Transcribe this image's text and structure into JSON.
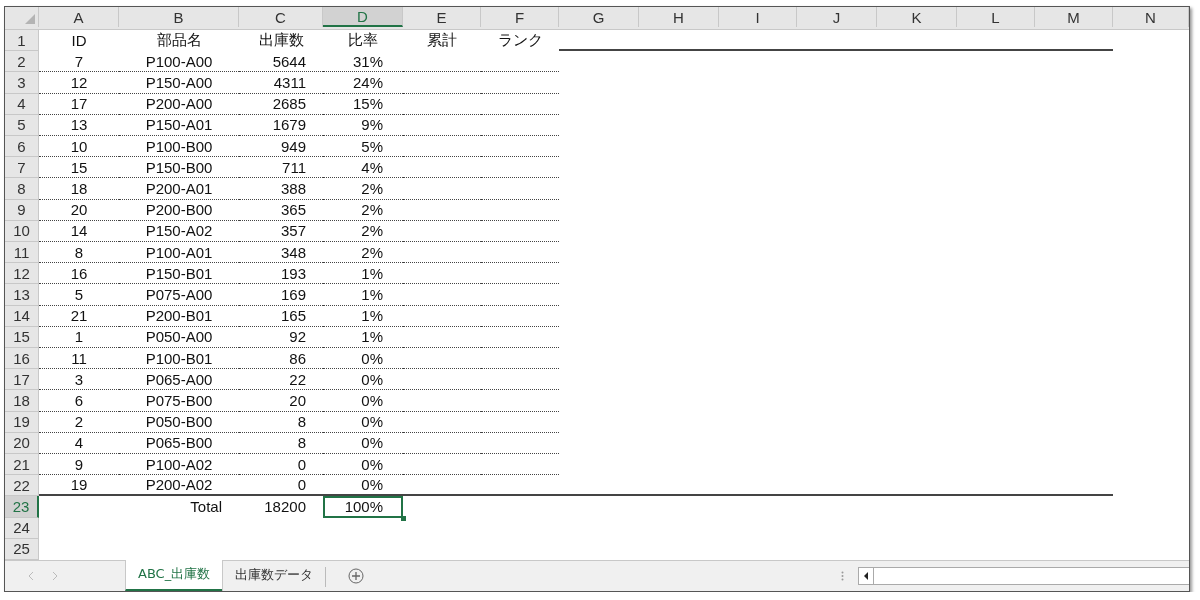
{
  "columns": [
    {
      "label": "A",
      "selected": false
    },
    {
      "label": "B",
      "selected": false
    },
    {
      "label": "C",
      "selected": false
    },
    {
      "label": "D",
      "selected": true
    },
    {
      "label": "E",
      "selected": false
    },
    {
      "label": "F",
      "selected": false
    },
    {
      "label": "G",
      "selected": false
    },
    {
      "label": "H",
      "selected": false
    },
    {
      "label": "I",
      "selected": false
    },
    {
      "label": "J",
      "selected": false
    },
    {
      "label": "K",
      "selected": false
    },
    {
      "label": "L",
      "selected": false
    },
    {
      "label": "M",
      "selected": false
    },
    {
      "label": "N",
      "selected": false
    }
  ],
  "header_row": {
    "number": "1",
    "selected": false,
    "cells": [
      "ID",
      "部品名",
      "出庫数",
      "比率",
      "累計",
      "ランク"
    ]
  },
  "rows": [
    {
      "number": "2",
      "selected": false,
      "id": "7",
      "part": "P100-A00",
      "qty": "5644",
      "ratio": "31%"
    },
    {
      "number": "3",
      "selected": false,
      "id": "12",
      "part": "P150-A00",
      "qty": "4311",
      "ratio": "24%"
    },
    {
      "number": "4",
      "selected": false,
      "id": "17",
      "part": "P200-A00",
      "qty": "2685",
      "ratio": "15%"
    },
    {
      "number": "5",
      "selected": false,
      "id": "13",
      "part": "P150-A01",
      "qty": "1679",
      "ratio": "9%"
    },
    {
      "number": "6",
      "selected": false,
      "id": "10",
      "part": "P100-B00",
      "qty": "949",
      "ratio": "5%"
    },
    {
      "number": "7",
      "selected": false,
      "id": "15",
      "part": "P150-B00",
      "qty": "711",
      "ratio": "4%"
    },
    {
      "number": "8",
      "selected": false,
      "id": "18",
      "part": "P200-A01",
      "qty": "388",
      "ratio": "2%"
    },
    {
      "number": "9",
      "selected": false,
      "id": "20",
      "part": "P200-B00",
      "qty": "365",
      "ratio": "2%"
    },
    {
      "number": "10",
      "selected": false,
      "id": "14",
      "part": "P150-A02",
      "qty": "357",
      "ratio": "2%"
    },
    {
      "number": "11",
      "selected": false,
      "id": "8",
      "part": "P100-A01",
      "qty": "348",
      "ratio": "2%"
    },
    {
      "number": "12",
      "selected": false,
      "id": "16",
      "part": "P150-B01",
      "qty": "193",
      "ratio": "1%"
    },
    {
      "number": "13",
      "selected": false,
      "id": "5",
      "part": "P075-A00",
      "qty": "169",
      "ratio": "1%"
    },
    {
      "number": "14",
      "selected": false,
      "id": "21",
      "part": "P200-B01",
      "qty": "165",
      "ratio": "1%"
    },
    {
      "number": "15",
      "selected": false,
      "id": "1",
      "part": "P050-A00",
      "qty": "92",
      "ratio": "1%"
    },
    {
      "number": "16",
      "selected": false,
      "id": "11",
      "part": "P100-B01",
      "qty": "86",
      "ratio": "0%"
    },
    {
      "number": "17",
      "selected": false,
      "id": "3",
      "part": "P065-A00",
      "qty": "22",
      "ratio": "0%"
    },
    {
      "number": "18",
      "selected": false,
      "id": "6",
      "part": "P075-B00",
      "qty": "20",
      "ratio": "0%"
    },
    {
      "number": "19",
      "selected": false,
      "id": "2",
      "part": "P050-B00",
      "qty": "8",
      "ratio": "0%"
    },
    {
      "number": "20",
      "selected": false,
      "id": "4",
      "part": "P065-B00",
      "qty": "8",
      "ratio": "0%"
    },
    {
      "number": "21",
      "selected": false,
      "id": "9",
      "part": "P100-A02",
      "qty": "0",
      "ratio": "0%"
    },
    {
      "number": "22",
      "selected": false,
      "id": "19",
      "part": "P200-A02",
      "qty": "0",
      "ratio": "0%"
    }
  ],
  "total_row": {
    "number": "23",
    "selected": true,
    "label": "Total",
    "qty": "18200",
    "ratio": "100%"
  },
  "empty_rows": [
    {
      "number": "24",
      "selected": false
    },
    {
      "number": "25",
      "selected": false
    }
  ],
  "sheet_tabs": [
    {
      "label": "ABC_出庫数",
      "selected": true
    },
    {
      "label": "出庫数データ",
      "selected": false
    }
  ]
}
